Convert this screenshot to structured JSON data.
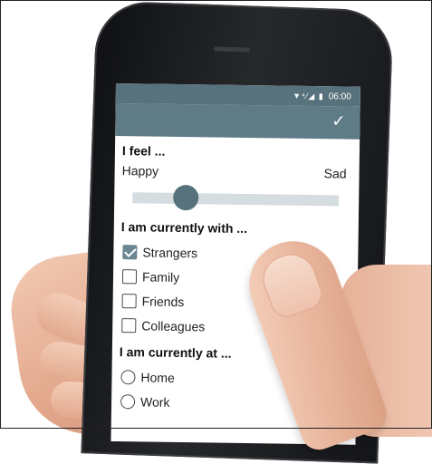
{
  "status_bar": {
    "icons": "▼⁴⁄◢ ▮",
    "time": "06:00"
  },
  "app_bar": {
    "confirm_icon": "check-icon"
  },
  "feel": {
    "title": "I feel ...",
    "left_label": "Happy",
    "right_label": "Sad",
    "slider_value": 0.26
  },
  "with": {
    "title": "I am currently with ...",
    "options": [
      {
        "label": "Strangers",
        "checked": true
      },
      {
        "label": "Family",
        "checked": false
      },
      {
        "label": "Friends",
        "checked": false
      },
      {
        "label": "Colleagues",
        "checked": false
      }
    ]
  },
  "at": {
    "title": "I am currently at ...",
    "options": [
      {
        "label": "Home",
        "selected": false
      },
      {
        "label": "Work",
        "selected": false
      }
    ]
  },
  "colors": {
    "primary": "#5f7b86",
    "statusbar": "#57727d",
    "accent": "#6a8793"
  }
}
